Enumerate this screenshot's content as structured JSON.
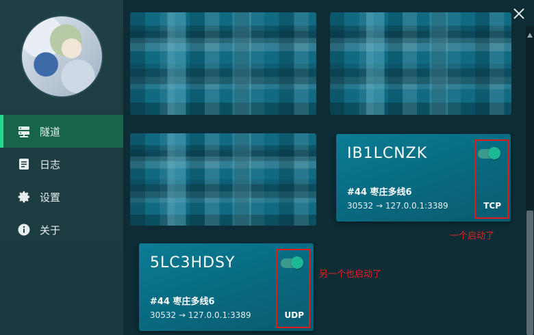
{
  "sidebar": {
    "items": [
      {
        "label": "隧道",
        "icon": "server-icon",
        "active": true
      },
      {
        "label": "日志",
        "icon": "document-icon",
        "active": false
      },
      {
        "label": "设置",
        "icon": "gear-icon",
        "active": false
      },
      {
        "label": "关于",
        "icon": "info-icon",
        "active": false
      }
    ]
  },
  "cards": [
    {
      "name": "IB1LCNZK",
      "node": "#44 枣庄多线6",
      "address": "30532 → 127.0.0.1:3389",
      "protocol": "TCP",
      "enabled": true
    },
    {
      "name": "5LC3HDSY",
      "node": "#44 枣庄多线6",
      "address": "30532 → 127.0.0.1:3389",
      "protocol": "UDP",
      "enabled": true
    }
  ],
  "annotations": {
    "note1": "一个启动了",
    "note2": "另一个也启动了"
  },
  "colors": {
    "accent": "#2fd38a",
    "active_bg": "#17644a",
    "card": "#0a7d95",
    "toggle_knob": "#1db996",
    "highlight": "#e01b1b"
  }
}
